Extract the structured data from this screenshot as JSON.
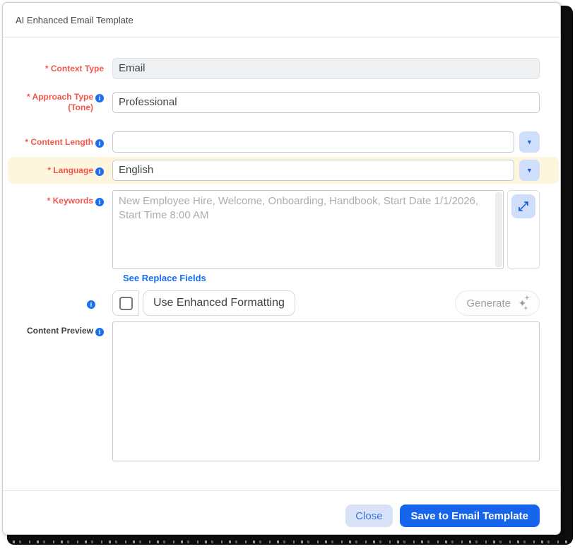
{
  "colors": {
    "accent_blue": "#1765ed",
    "required_red": "#f4564a",
    "highlight_row": "#fdf5dd",
    "info_icon_blue": "#1d6ff2",
    "link_blue": "#1a6ef5",
    "dropdown_btn_bg": "#cfdffb"
  },
  "modal": {
    "title": "AI Enhanced Email Template",
    "fields": {
      "context_type": {
        "label": "* Context Type",
        "value": "Email"
      },
      "approach_type": {
        "label": "* Approach Type",
        "label_line2": "(Tone)",
        "value": "Professional"
      },
      "content_length": {
        "label": "* Content Length",
        "value": ""
      },
      "language": {
        "label": "* Language",
        "value": "English"
      },
      "keywords": {
        "label": "* Keywords",
        "value": "",
        "placeholder": "New Employee Hire, Welcome, Onboarding, Handbook, Start Date 1/1/2026, Start Time 8:00 AM"
      },
      "content_preview": {
        "label": "Content Preview",
        "value": ""
      }
    },
    "links": {
      "see_replace_fields": "See Replace Fields"
    },
    "formatting": {
      "checkbox_label": "Use Enhanced Formatting",
      "checked": false
    },
    "buttons": {
      "generate": "Generate",
      "close": "Close",
      "save": "Save to Email Template"
    },
    "icons": {
      "info": "i",
      "dropdown_caret": "▼",
      "expand": "⤢",
      "sparkle": "✦",
      "plus": "+"
    }
  }
}
